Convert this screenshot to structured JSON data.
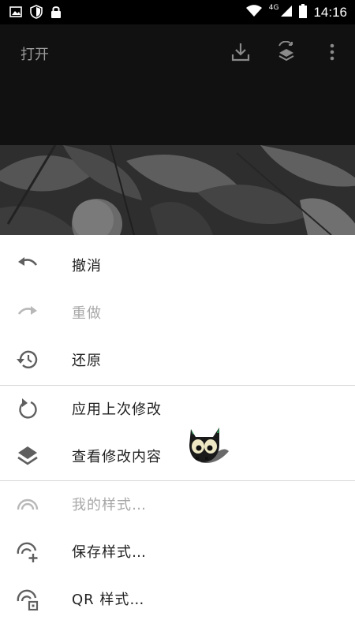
{
  "status_bar": {
    "network": "4G",
    "time": "14:16",
    "icons": [
      "image-icon",
      "shield-icon",
      "lock-icon",
      "wifi-icon",
      "signal-icon",
      "battery-icon"
    ]
  },
  "app_bar": {
    "title": "打开",
    "actions": [
      "download-icon",
      "layers-sync-icon",
      "more-vert-icon"
    ]
  },
  "menu": {
    "items": [
      {
        "label": "撤消",
        "icon": "undo-icon",
        "enabled": true
      },
      {
        "label": "重做",
        "icon": "redo-icon",
        "enabled": false
      },
      {
        "label": "还原",
        "icon": "history-icon",
        "enabled": true
      },
      {
        "label": "应用上次修改",
        "icon": "rotate-icon",
        "enabled": true
      },
      {
        "label": "查看修改内容",
        "icon": "layers-icon",
        "enabled": true
      },
      {
        "label": "我的样式…",
        "icon": "style-arc-icon",
        "enabled": false
      },
      {
        "label": "保存样式…",
        "icon": "style-add-icon",
        "enabled": true
      },
      {
        "label": "QR 样式…",
        "icon": "style-qr-icon",
        "enabled": true
      }
    ]
  },
  "colors": {
    "status_bar": "#000000",
    "app_bar": "#111111",
    "menu_bg": "#ffffff",
    "icon": "#5f5f5f",
    "disabled": "#a8a8a8"
  }
}
